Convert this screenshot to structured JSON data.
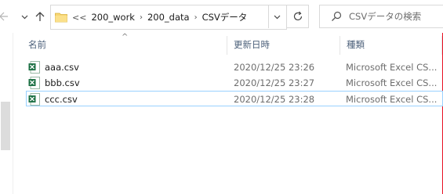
{
  "nav": {
    "back_icon": "arrow-left-icon",
    "forward_icon": "arrow-right-icon",
    "history_icon": "chevron-down-icon",
    "up_icon": "arrow-up-icon"
  },
  "address": {
    "lead": "<<",
    "crumbs": [
      "200_work",
      "200_data",
      "CSVデータ"
    ],
    "separator": "›",
    "folder_icon": "folder-icon",
    "refresh_icon": "refresh-icon"
  },
  "search": {
    "placeholder": "CSVデータの検索",
    "icon": "search-icon"
  },
  "columns": {
    "name": "名前",
    "date": "更新日時",
    "type": "種類",
    "sort_indicator": "^"
  },
  "files": [
    {
      "name": "aaa.csv",
      "modified": "2020/12/25 23:26",
      "type": "Microsoft Excel CS..."
    },
    {
      "name": "bbb.csv",
      "modified": "2020/12/25 23:27",
      "type": "Microsoft Excel CS..."
    },
    {
      "name": "ccc.csv",
      "modified": "2020/12/25 23:28",
      "type": "Microsoft Excel CS..."
    }
  ],
  "colors": {
    "accent_border": "#e81123",
    "focus": "#99d1ff",
    "folder": "#f4c542",
    "excel": "#1e7145"
  }
}
